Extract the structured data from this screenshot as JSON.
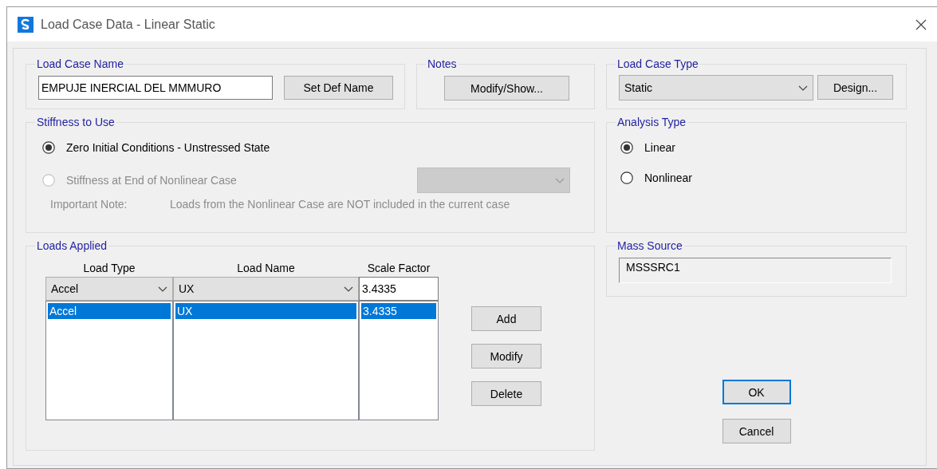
{
  "window": {
    "title": "Load Case Data - Linear Static"
  },
  "load_case_name": {
    "label": "Load Case Name",
    "value": "EMPUJE INERCIAL DEL MMMURO",
    "button": "Set Def Name"
  },
  "notes": {
    "label": "Notes",
    "button": "Modify/Show..."
  },
  "load_case_type": {
    "label": "Load Case Type",
    "value": "Static",
    "button": "Design..."
  },
  "stiffness": {
    "label": "Stiffness to Use",
    "options": [
      {
        "label": "Zero Initial Conditions - Unstressed State",
        "selected": true,
        "disabled": false
      },
      {
        "label": "Stiffness at End of Nonlinear Case",
        "selected": false,
        "disabled": true
      }
    ],
    "case_dropdown": {
      "disabled": true
    },
    "note_label": "Important Note:",
    "note_text": "Loads from the Nonlinear Case are NOT included in the current case"
  },
  "analysis_type": {
    "label": "Analysis Type",
    "options": [
      {
        "label": "Linear",
        "selected": true,
        "disabled": false
      },
      {
        "label": "Nonlinear",
        "selected": false,
        "disabled": false
      }
    ]
  },
  "loads_applied": {
    "label": "Loads Applied",
    "columns": [
      "Load Type",
      "Load Name",
      "Scale Factor"
    ],
    "editor": [
      "Accel",
      "UX",
      "3.4335"
    ],
    "rows": [
      {
        "cells": [
          "Accel",
          "UX",
          "3.4335"
        ],
        "selected": true
      }
    ],
    "buttons": [
      "Add",
      "Modify",
      "Delete"
    ]
  },
  "mass_source": {
    "label": "Mass Source",
    "value": "MSSSRC1"
  },
  "buttons": [
    {
      "label": "OK",
      "default": true
    },
    {
      "label": "Cancel",
      "default": false
    }
  ]
}
